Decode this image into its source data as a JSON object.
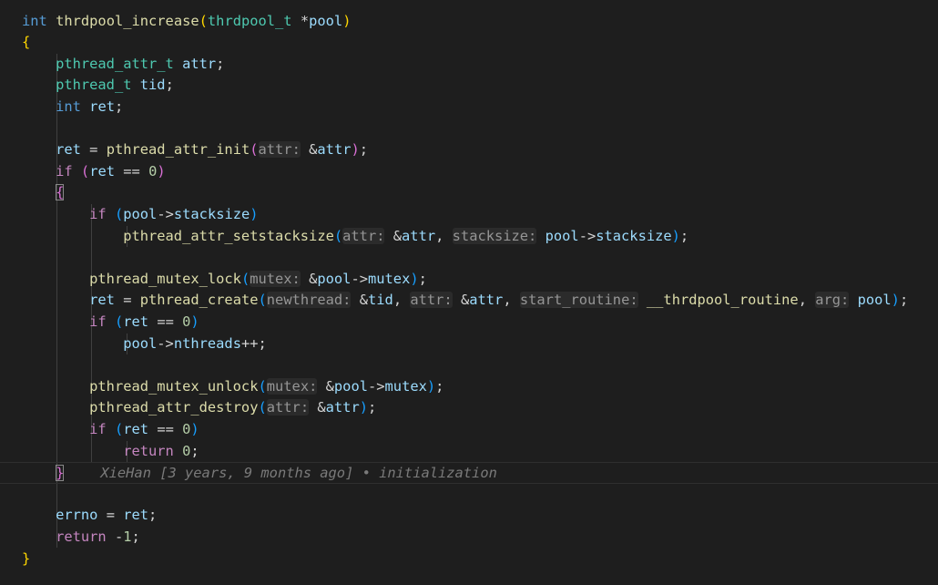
{
  "editor": {
    "language": "c",
    "blame": "XieHan [3 years, 9 months ago] • initialization",
    "lines": [
      [
        [
          "k",
          "int"
        ],
        [
          "p",
          " "
        ],
        [
          "f",
          "thrdpool_increase"
        ],
        [
          "b1",
          "("
        ],
        [
          "t",
          "thrdpool_t"
        ],
        [
          "p",
          " *"
        ],
        [
          "v",
          "pool"
        ],
        [
          "b1",
          ")"
        ]
      ],
      [
        [
          "b1",
          "{"
        ]
      ],
      [
        [
          "p",
          "    "
        ],
        [
          "t",
          "pthread_attr_t"
        ],
        [
          "p",
          " "
        ],
        [
          "v",
          "attr"
        ],
        [
          "p",
          ";"
        ]
      ],
      [
        [
          "p",
          "    "
        ],
        [
          "t",
          "pthread_t"
        ],
        [
          "p",
          " "
        ],
        [
          "v",
          "tid"
        ],
        [
          "p",
          ";"
        ]
      ],
      [
        [
          "p",
          "    "
        ],
        [
          "k",
          "int"
        ],
        [
          "p",
          " "
        ],
        [
          "v",
          "ret"
        ],
        [
          "p",
          ";"
        ]
      ],
      [],
      [
        [
          "p",
          "    "
        ],
        [
          "v",
          "ret"
        ],
        [
          "p",
          " = "
        ],
        [
          "f",
          "pthread_attr_init"
        ],
        [
          "b2",
          "("
        ],
        [
          "hint",
          "attr:"
        ],
        [
          "p",
          " &"
        ],
        [
          "v",
          "attr"
        ],
        [
          "b2",
          ")"
        ],
        [
          "p",
          ";"
        ]
      ],
      [
        [
          "p",
          "    "
        ],
        [
          "ctl",
          "if"
        ],
        [
          "p",
          " "
        ],
        [
          "b2",
          "("
        ],
        [
          "v",
          "ret"
        ],
        [
          "p",
          " == "
        ],
        [
          "n",
          "0"
        ],
        [
          "b2",
          ")"
        ]
      ],
      [
        [
          "p",
          "    "
        ],
        [
          "b2",
          "{"
        ]
      ],
      [
        [
          "p",
          "        "
        ],
        [
          "ctl",
          "if"
        ],
        [
          "p",
          " "
        ],
        [
          "b3",
          "("
        ],
        [
          "v",
          "pool"
        ],
        [
          "p",
          "->"
        ],
        [
          "v",
          "stacksize"
        ],
        [
          "b3",
          ")"
        ]
      ],
      [
        [
          "p",
          "            "
        ],
        [
          "f",
          "pthread_attr_setstacksize"
        ],
        [
          "b3",
          "("
        ],
        [
          "hint",
          "attr:"
        ],
        [
          "p",
          " &"
        ],
        [
          "v",
          "attr"
        ],
        [
          "p",
          ", "
        ],
        [
          "hint",
          "stacksize:"
        ],
        [
          "p",
          " "
        ],
        [
          "v",
          "pool"
        ],
        [
          "p",
          "->"
        ],
        [
          "v",
          "stacksize"
        ],
        [
          "b3",
          ")"
        ],
        [
          "p",
          ";"
        ]
      ],
      [],
      [
        [
          "p",
          "        "
        ],
        [
          "f",
          "pthread_mutex_lock"
        ],
        [
          "b3",
          "("
        ],
        [
          "hint",
          "mutex:"
        ],
        [
          "p",
          " &"
        ],
        [
          "v",
          "pool"
        ],
        [
          "p",
          "->"
        ],
        [
          "v",
          "mutex"
        ],
        [
          "b3",
          ")"
        ],
        [
          "p",
          ";"
        ]
      ],
      [
        [
          "p",
          "        "
        ],
        [
          "v",
          "ret"
        ],
        [
          "p",
          " = "
        ],
        [
          "f",
          "pthread_create"
        ],
        [
          "b3",
          "("
        ],
        [
          "hint",
          "newthread:"
        ],
        [
          "p",
          " &"
        ],
        [
          "v",
          "tid"
        ],
        [
          "p",
          ", "
        ],
        [
          "hint",
          "attr:"
        ],
        [
          "p",
          " &"
        ],
        [
          "v",
          "attr"
        ],
        [
          "p",
          ", "
        ],
        [
          "hint",
          "start_routine:"
        ],
        [
          "p",
          " "
        ],
        [
          "f",
          "__thrdpool_routine"
        ],
        [
          "p",
          ", "
        ],
        [
          "hint",
          "arg:"
        ],
        [
          "p",
          " "
        ],
        [
          "v",
          "pool"
        ],
        [
          "b3",
          ")"
        ],
        [
          "p",
          ";"
        ]
      ],
      [
        [
          "p",
          "        "
        ],
        [
          "ctl",
          "if"
        ],
        [
          "p",
          " "
        ],
        [
          "b3",
          "("
        ],
        [
          "v",
          "ret"
        ],
        [
          "p",
          " == "
        ],
        [
          "n",
          "0"
        ],
        [
          "b3",
          ")"
        ]
      ],
      [
        [
          "p",
          "            "
        ],
        [
          "v",
          "pool"
        ],
        [
          "p",
          "->"
        ],
        [
          "v",
          "nthreads"
        ],
        [
          "p",
          "++;"
        ]
      ],
      [],
      [
        [
          "p",
          "        "
        ],
        [
          "f",
          "pthread_mutex_unlock"
        ],
        [
          "b3",
          "("
        ],
        [
          "hint",
          "mutex:"
        ],
        [
          "p",
          " &"
        ],
        [
          "v",
          "pool"
        ],
        [
          "p",
          "->"
        ],
        [
          "v",
          "mutex"
        ],
        [
          "b3",
          ")"
        ],
        [
          "p",
          ";"
        ]
      ],
      [
        [
          "p",
          "        "
        ],
        [
          "f",
          "pthread_attr_destroy"
        ],
        [
          "b3",
          "("
        ],
        [
          "hint",
          "attr:"
        ],
        [
          "p",
          " &"
        ],
        [
          "v",
          "attr"
        ],
        [
          "b3",
          ")"
        ],
        [
          "p",
          ";"
        ]
      ],
      [
        [
          "p",
          "        "
        ],
        [
          "ctl",
          "if"
        ],
        [
          "p",
          " "
        ],
        [
          "b3",
          "("
        ],
        [
          "v",
          "ret"
        ],
        [
          "p",
          " == "
        ],
        [
          "n",
          "0"
        ],
        [
          "b3",
          ")"
        ]
      ],
      [
        [
          "p",
          "            "
        ],
        [
          "ctl",
          "return"
        ],
        [
          "p",
          " "
        ],
        [
          "n",
          "0"
        ],
        [
          "p",
          ";"
        ]
      ],
      [
        [
          "p",
          "    "
        ],
        [
          "b2",
          "}"
        ]
      ],
      [],
      [
        [
          "p",
          "    "
        ],
        [
          "v",
          "errno"
        ],
        [
          "p",
          " = "
        ],
        [
          "v",
          "ret"
        ],
        [
          "p",
          ";"
        ]
      ],
      [
        [
          "p",
          "    "
        ],
        [
          "ctl",
          "return"
        ],
        [
          "p",
          " -"
        ],
        [
          "n",
          "1"
        ],
        [
          "p",
          ";"
        ]
      ],
      [
        [
          "b1",
          "}"
        ]
      ]
    ]
  }
}
